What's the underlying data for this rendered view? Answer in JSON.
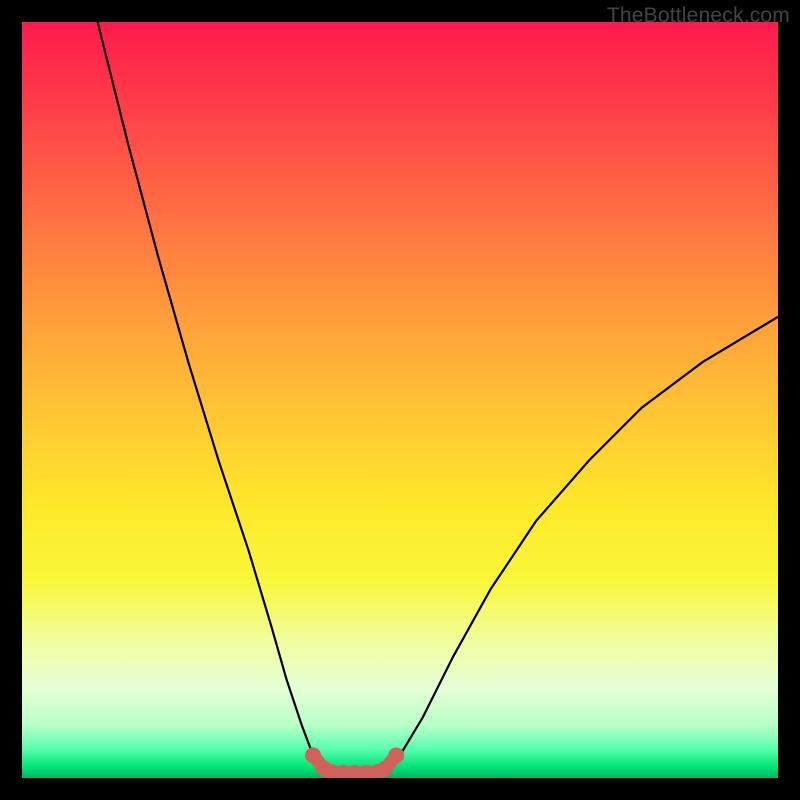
{
  "watermark": "TheBottleneck.com",
  "chart_data": {
    "type": "line",
    "title": "",
    "xlabel": "",
    "ylabel": "",
    "xlim": [
      0,
      100
    ],
    "ylim": [
      0,
      100
    ],
    "grid": false,
    "series": [
      {
        "name": "curve-left",
        "x": [
          10,
          14,
          18,
          22,
          26,
          30,
          33,
          35,
          37,
          38.5,
          40
        ],
        "values": [
          100,
          84,
          69,
          55,
          42,
          30,
          20,
          13,
          7,
          3,
          1.2
        ]
      },
      {
        "name": "curve-right",
        "x": [
          48,
          50,
          53,
          57,
          62,
          68,
          75,
          82,
          90,
          100
        ],
        "values": [
          1.2,
          3,
          8,
          16,
          25,
          34,
          42,
          49,
          55,
          61
        ]
      },
      {
        "name": "marker-band",
        "x": [
          38.5,
          40,
          41,
          42.5,
          44,
          45.5,
          47,
          48,
          49.5
        ],
        "values": [
          3,
          1.2,
          0.8,
          0.7,
          0.7,
          0.7,
          0.8,
          1.2,
          3
        ]
      }
    ],
    "colors": {
      "curve": "#000000",
      "marker": "#d1625b"
    }
  }
}
